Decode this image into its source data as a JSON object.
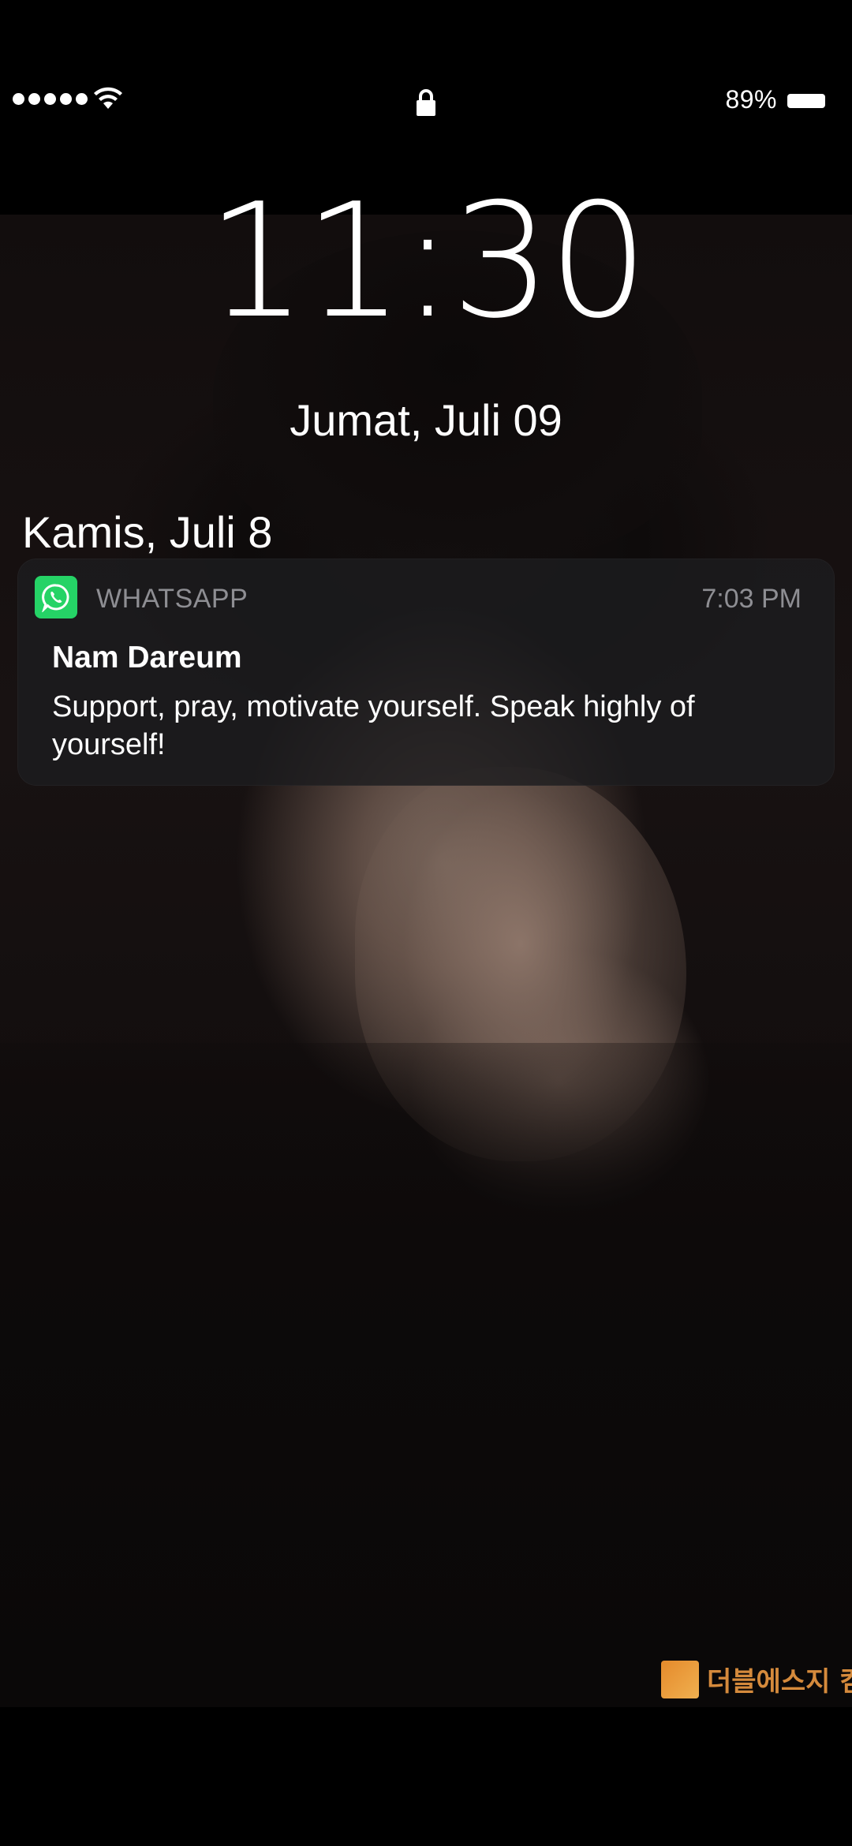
{
  "status_bar": {
    "signal_icon": "signal-dots-icon",
    "wifi_icon": "wifi-icon",
    "lock_icon": "lock-icon",
    "battery_percent": "89%",
    "battery_icon": "battery-icon"
  },
  "lock_screen": {
    "time": "11:30",
    "date": "Jumat, Juli 09"
  },
  "notifications_section": {
    "date_header": "Kamis, Juli 8"
  },
  "notification": {
    "app_icon": "whatsapp-icon",
    "app_name": "WHATSAPP",
    "time": "7:03 PM",
    "sender": "Nam Dareum",
    "message": "Support, pray, motivate yourself. Speak highly of yourself!"
  },
  "wallpaper": {
    "watermark_logo": "SS",
    "watermark_text": "더블에스지 컴"
  },
  "colors": {
    "whatsapp_green": "#25d366",
    "notification_bg": "#1c1c1e",
    "secondary_text": "#8e8e93"
  }
}
